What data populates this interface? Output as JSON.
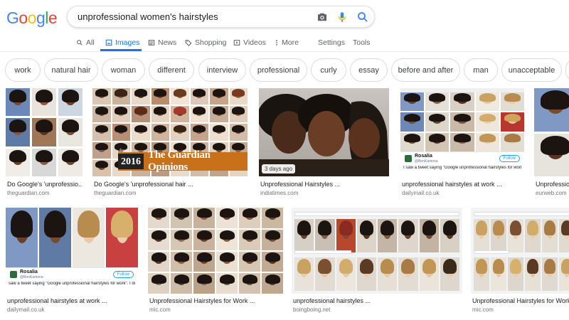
{
  "logo": {
    "letters": [
      "G",
      "o",
      "o",
      "g",
      "l",
      "e"
    ],
    "colors": [
      "#4285F4",
      "#EA4335",
      "#FBBC05",
      "#4285F4",
      "#34A853",
      "#EA4335"
    ]
  },
  "search": {
    "query": "unprofessional women's hairstyles"
  },
  "tabs": [
    {
      "label": "All",
      "icon": "search-icon"
    },
    {
      "label": "Images",
      "icon": "image-icon",
      "active": true
    },
    {
      "label": "News",
      "icon": "news-icon"
    },
    {
      "label": "Shopping",
      "icon": "tag-icon"
    },
    {
      "label": "Videos",
      "icon": "play-icon"
    },
    {
      "label": "More",
      "icon": "more-vert-icon"
    },
    {
      "label": "Settings"
    },
    {
      "label": "Tools"
    }
  ],
  "chips": [
    "work",
    "natural hair",
    "woman",
    "different",
    "interview",
    "professional",
    "curly",
    "essay",
    "before and after",
    "man",
    "unacceptable"
  ],
  "results": [
    {
      "caption": "Do Google's 'unprofessio...",
      "source": "theguardian.com"
    },
    {
      "caption": "Do Google's 'unprofessional hair ...",
      "source": "theguardian.com",
      "overlay_small": "from",
      "overlay_year": "2016",
      "overlay_text": "The Guardian Opinions"
    },
    {
      "caption": "Unprofessional Hairstyles ...",
      "source": "indiatimes.com",
      "badge": "3 days ago"
    },
    {
      "caption": "unprofessional hairstyles at work ...",
      "source": "dailymail.co.uk",
      "tweet_name": "Rosalia",
      "tweet_handle": "@BonKamona",
      "tweet_follow": "Follow",
      "tweet_text": "I saw a tweet saying \"Google unprofessional hairstyles for work\". I did. Then I checked the 'professional' ones 😳😳😳"
    },
    {
      "caption": "Unprofession...",
      "source": "eurweb.com"
    },
    {
      "caption": "unprofessional hairstyles at work ...",
      "source": "dailymail.co.uk",
      "tweet_name": "Rosalia",
      "tweet_handle": "@BonKamona",
      "tweet_follow": "Follow",
      "tweet_text": "saw a tweet saying \"Google unprofessional hairstyles for work\". I did. Then I checked the 'professional' ones 😳😳😳"
    },
    {
      "caption": "Unprofessional Hairstyles for Work ...",
      "source": "mic.com"
    },
    {
      "caption": "unprofessional hairstyles ...",
      "source": "boingboing.net"
    },
    {
      "caption": "Unprofessional Hairstyles for Work ...",
      "source": "mic.com"
    }
  ],
  "colors": {
    "accent": "#1a73e8",
    "muted": "#5f6368",
    "border": "#dadce0"
  }
}
